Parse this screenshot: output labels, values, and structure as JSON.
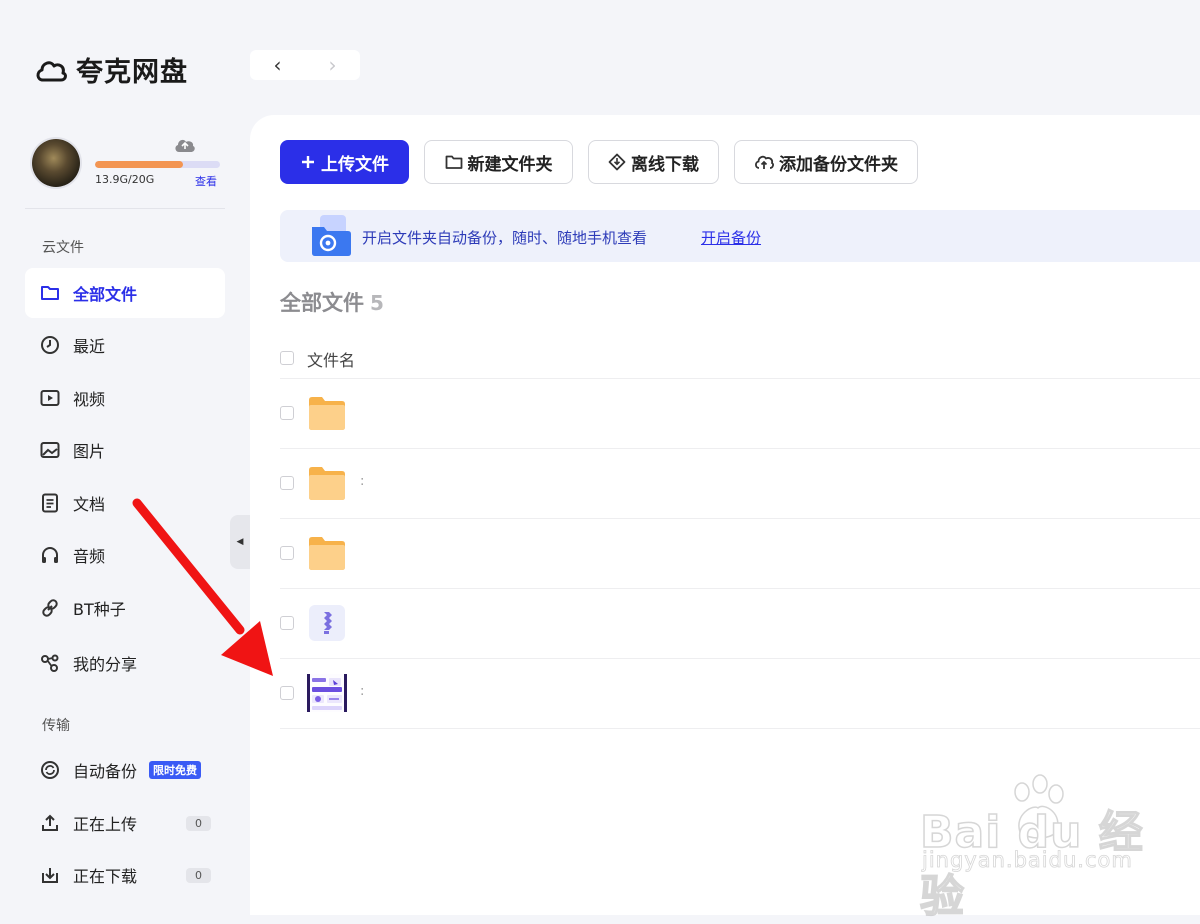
{
  "app": {
    "title": "夸克网盘"
  },
  "user": {
    "storage_used": 0.7,
    "storage_text": "13.9G/20G",
    "storage_link": "查看"
  },
  "sidebar": {
    "section_cloud": "云文件",
    "cloud_items": [
      {
        "label": "全部文件",
        "icon": "folder-icon",
        "active": true
      },
      {
        "label": "最近",
        "icon": "clock-icon"
      },
      {
        "label": "视频",
        "icon": "video-icon"
      },
      {
        "label": "图片",
        "icon": "image-icon"
      },
      {
        "label": "文档",
        "icon": "document-icon"
      },
      {
        "label": "音频",
        "icon": "headphones-icon"
      },
      {
        "label": "BT种子",
        "icon": "link-icon"
      },
      {
        "label": "我的分享",
        "icon": "share-icon"
      }
    ],
    "section_transfer": "传输",
    "transfer_items": [
      {
        "label": "自动备份",
        "icon": "sync-icon",
        "badge": "限时免费"
      },
      {
        "label": "正在上传",
        "icon": "upload-icon",
        "count": "0"
      },
      {
        "label": "正在下载",
        "icon": "download-icon",
        "count": "0"
      }
    ]
  },
  "toolbar": {
    "upload": "上传文件",
    "new_folder": "新建文件夹",
    "offline_download": "离线下载",
    "add_backup_folder": "添加备份文件夹"
  },
  "banner": {
    "text": "开启文件夹自动备份，随时、随地手机查看",
    "link": "开启备份"
  },
  "main": {
    "title": "全部文件",
    "count": "5"
  },
  "table": {
    "column_name": "文件名",
    "rows": [
      {
        "type": "folder",
        "name": ""
      },
      {
        "type": "folder",
        "name": ":"
      },
      {
        "type": "folder",
        "name": ""
      },
      {
        "type": "document",
        "name": ""
      },
      {
        "type": "image",
        "name": ":"
      }
    ]
  },
  "watermark": {
    "main": "Bai du 经验",
    "sub": "jingyan.baidu.com"
  },
  "colors": {
    "accent": "#2b2fe8",
    "storage_fill": "#f39552",
    "banner_bg": "#eef1fb",
    "annotation_arrow": "#f01414"
  }
}
